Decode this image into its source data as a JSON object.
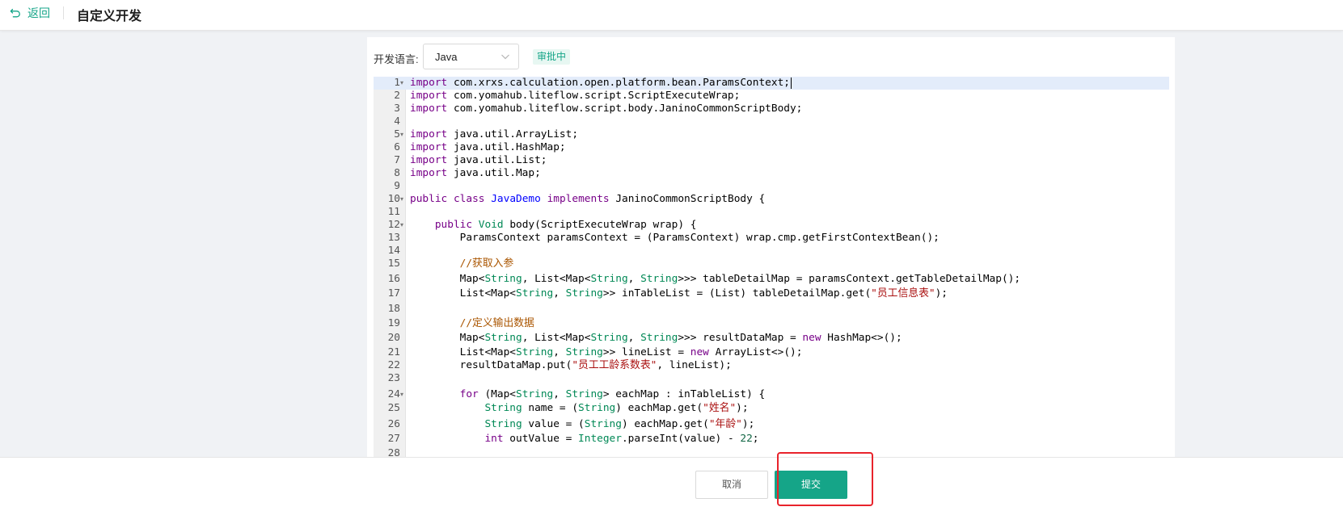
{
  "header": {
    "back_label": "返回",
    "title": "自定义开发"
  },
  "form": {
    "language_label": "开发语言:",
    "language_value": "Java",
    "status_badge": "审批中"
  },
  "editor": {
    "active_line": 1,
    "lines": [
      {
        "n": "1",
        "fold": true,
        "tokens": [
          [
            "kw",
            "import"
          ],
          [
            "t",
            " com.xrxs.calculation.open.platform.bean.ParamsContext;"
          ]
        ]
      },
      {
        "n": "2",
        "fold": false,
        "tokens": [
          [
            "kw",
            "import"
          ],
          [
            "t",
            " com.yomahub.liteflow.script.ScriptExecuteWrap;"
          ]
        ]
      },
      {
        "n": "3",
        "fold": false,
        "tokens": [
          [
            "kw",
            "import"
          ],
          [
            "t",
            " com.yomahub.liteflow.script.body.JaninoCommonScriptBody;"
          ]
        ]
      },
      {
        "n": "4",
        "fold": false,
        "tokens": []
      },
      {
        "n": "5",
        "fold": true,
        "tokens": [
          [
            "kw",
            "import"
          ],
          [
            "t",
            " java.util.ArrayList;"
          ]
        ]
      },
      {
        "n": "6",
        "fold": false,
        "tokens": [
          [
            "kw",
            "import"
          ],
          [
            "t",
            " java.util.HashMap;"
          ]
        ]
      },
      {
        "n": "7",
        "fold": false,
        "tokens": [
          [
            "kw",
            "import"
          ],
          [
            "t",
            " java.util.List;"
          ]
        ]
      },
      {
        "n": "8",
        "fold": false,
        "tokens": [
          [
            "kw",
            "import"
          ],
          [
            "t",
            " java.util.Map;"
          ]
        ]
      },
      {
        "n": "9",
        "fold": false,
        "tokens": []
      },
      {
        "n": "10",
        "fold": true,
        "tokens": [
          [
            "kw",
            "public"
          ],
          [
            "t",
            " "
          ],
          [
            "kw",
            "class"
          ],
          [
            "t",
            " "
          ],
          [
            "cls",
            "JavaDemo"
          ],
          [
            "t",
            " "
          ],
          [
            "kw",
            "implements"
          ],
          [
            "t",
            " JaninoCommonScriptBody {"
          ]
        ]
      },
      {
        "n": "11",
        "fold": false,
        "tokens": []
      },
      {
        "n": "12",
        "fold": true,
        "tokens": [
          [
            "t",
            "    "
          ],
          [
            "kw",
            "public"
          ],
          [
            "t",
            " "
          ],
          [
            "type",
            "Void"
          ],
          [
            "t",
            " body(ScriptExecuteWrap wrap) {"
          ]
        ]
      },
      {
        "n": "13",
        "fold": false,
        "tokens": [
          [
            "t",
            "        ParamsContext paramsContext = (ParamsContext) wrap.cmp.getFirstContextBean();"
          ]
        ]
      },
      {
        "n": "14",
        "fold": false,
        "tokens": []
      },
      {
        "n": "15",
        "fold": false,
        "tokens": [
          [
            "t",
            "        "
          ],
          [
            "cm",
            "//获取入参"
          ]
        ]
      },
      {
        "n": "16",
        "fold": false,
        "tokens": [
          [
            "t",
            "        Map<"
          ],
          [
            "type",
            "String"
          ],
          [
            "t",
            ", List<Map<"
          ],
          [
            "type",
            "String"
          ],
          [
            "t",
            ", "
          ],
          [
            "type",
            "String"
          ],
          [
            "t",
            ">>> tableDetailMap = paramsContext.getTableDetailMap();"
          ]
        ]
      },
      {
        "n": "17",
        "fold": false,
        "tokens": [
          [
            "t",
            "        List<Map<"
          ],
          [
            "type",
            "String"
          ],
          [
            "t",
            ", "
          ],
          [
            "type",
            "String"
          ],
          [
            "t",
            ">> inTableList = (List) tableDetailMap.get("
          ],
          [
            "str",
            "\"员工信息表\""
          ],
          [
            "t",
            ");"
          ]
        ]
      },
      {
        "n": "18",
        "fold": false,
        "tokens": []
      },
      {
        "n": "19",
        "fold": false,
        "tokens": [
          [
            "t",
            "        "
          ],
          [
            "cm",
            "//定义输出数据"
          ]
        ]
      },
      {
        "n": "20",
        "fold": false,
        "tokens": [
          [
            "t",
            "        Map<"
          ],
          [
            "type",
            "String"
          ],
          [
            "t",
            ", List<Map<"
          ],
          [
            "type",
            "String"
          ],
          [
            "t",
            ", "
          ],
          [
            "type",
            "String"
          ],
          [
            "t",
            ">>> resultDataMap = "
          ],
          [
            "kw",
            "new"
          ],
          [
            "t",
            " HashMap<>();"
          ]
        ]
      },
      {
        "n": "21",
        "fold": false,
        "tokens": [
          [
            "t",
            "        List<Map<"
          ],
          [
            "type",
            "String"
          ],
          [
            "t",
            ", "
          ],
          [
            "type",
            "String"
          ],
          [
            "t",
            ">> lineList = "
          ],
          [
            "kw",
            "new"
          ],
          [
            "t",
            " ArrayList<>();"
          ]
        ]
      },
      {
        "n": "22",
        "fold": false,
        "tokens": [
          [
            "t",
            "        resultDataMap.put("
          ],
          [
            "str",
            "\"员工工龄系数表\""
          ],
          [
            "t",
            ", lineList);"
          ]
        ]
      },
      {
        "n": "23",
        "fold": false,
        "tokens": []
      },
      {
        "n": "24",
        "fold": true,
        "tokens": [
          [
            "t",
            "        "
          ],
          [
            "kw",
            "for"
          ],
          [
            "t",
            " (Map<"
          ],
          [
            "type",
            "String"
          ],
          [
            "t",
            ", "
          ],
          [
            "type",
            "String"
          ],
          [
            "t",
            "> eachMap : inTableList) {"
          ]
        ]
      },
      {
        "n": "25",
        "fold": false,
        "tokens": [
          [
            "t",
            "            "
          ],
          [
            "type",
            "String"
          ],
          [
            "t",
            " name = ("
          ],
          [
            "type",
            "String"
          ],
          [
            "t",
            ") eachMap.get("
          ],
          [
            "str",
            "\"姓名\""
          ],
          [
            "t",
            ");"
          ]
        ]
      },
      {
        "n": "26",
        "fold": false,
        "tokens": [
          [
            "t",
            "            "
          ],
          [
            "type",
            "String"
          ],
          [
            "t",
            " value = ("
          ],
          [
            "type",
            "String"
          ],
          [
            "t",
            ") eachMap.get("
          ],
          [
            "str",
            "\"年龄\""
          ],
          [
            "t",
            ");"
          ]
        ]
      },
      {
        "n": "27",
        "fold": false,
        "tokens": [
          [
            "t",
            "            "
          ],
          [
            "kw",
            "int"
          ],
          [
            "t",
            " outValue = "
          ],
          [
            "type",
            "Integer"
          ],
          [
            "t",
            ".parseInt(value) - "
          ],
          [
            "num",
            "22"
          ],
          [
            "t",
            ";"
          ]
        ]
      },
      {
        "n": "28",
        "fold": false,
        "tokens": []
      }
    ]
  },
  "footer": {
    "cancel_label": "取消",
    "submit_label": "提交"
  },
  "colors": {
    "accent": "#15a588",
    "keyword": "#770088",
    "type": "#008855",
    "class_name": "#0000ff",
    "comment": "#aa5500",
    "string": "#aa1111",
    "number": "#116644",
    "highlight_box": "#e8232b"
  }
}
